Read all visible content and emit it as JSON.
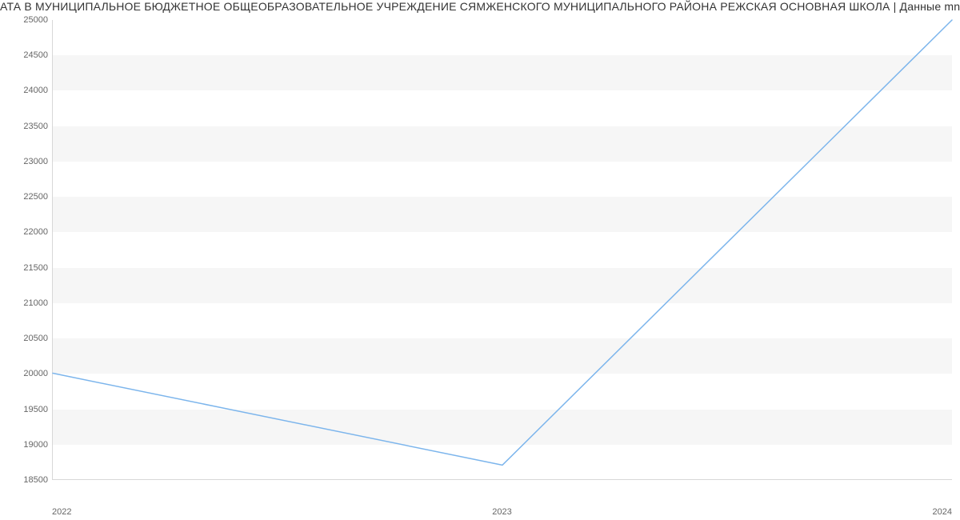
{
  "chart_data": {
    "type": "line",
    "title": "АТА В МУНИЦИПАЛЬНОЕ БЮДЖЕТНОЕ ОБЩЕОБРАЗОВАТЕЛЬНОЕ УЧРЕЖДЕНИЕ СЯМЖЕНСКОГО МУНИЦИПАЛЬНОГО РАЙОНА РЕЖСКАЯ ОСНОВНАЯ ШКОЛА | Данные mnog",
    "xlabel": "",
    "ylabel": "",
    "categories": [
      "2022",
      "2023",
      "2024"
    ],
    "values": [
      20000,
      18700,
      25000
    ],
    "ylim": [
      18500,
      25000
    ],
    "y_ticks": [
      18500,
      19000,
      19500,
      20000,
      20500,
      21000,
      21500,
      22000,
      22500,
      23000,
      23500,
      24000,
      24500,
      25000
    ],
    "series_color": "#7cb5ec"
  }
}
